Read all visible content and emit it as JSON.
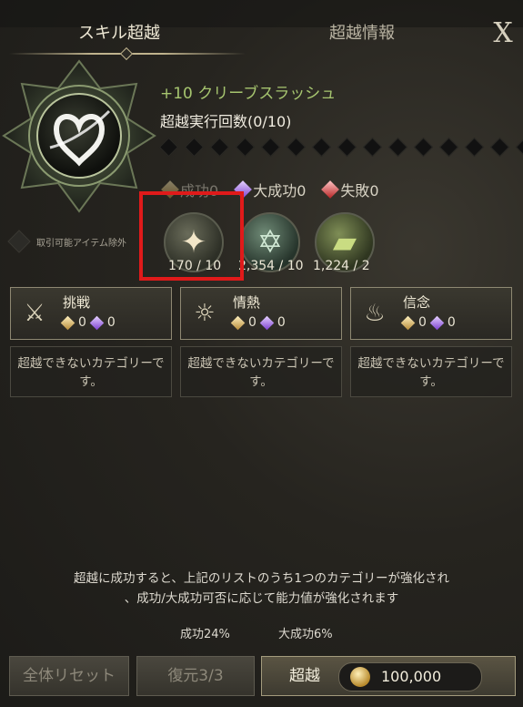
{
  "tabs": {
    "skill": "スキル超越",
    "info": "超越情報"
  },
  "close_label": "X",
  "skill": {
    "level_name": "+10 クリーブスラッシュ",
    "attempts": "超越実行回数(0/10)"
  },
  "legend": {
    "success": "成功0",
    "great_success": "大成功0",
    "failure": "失敗0"
  },
  "tradeable_label": "取引可能アイテム除外",
  "materials": [
    {
      "icon": "star-crystal-icon",
      "count": "170 / 10"
    },
    {
      "icon": "hexagram-crystal-icon",
      "count": "2,354 / 10"
    },
    {
      "icon": "scroll-icon",
      "count": "1,224 / 2"
    }
  ],
  "categories": [
    {
      "name": "挑戦",
      "icon": "sword-crest-icon",
      "gold": "0",
      "purple": "0",
      "note": "超越できないカテゴリーです。"
    },
    {
      "name": "情熱",
      "icon": "praying-hands-icon",
      "gold": "0",
      "purple": "0",
      "note": "超越できないカテゴリーです。"
    },
    {
      "name": "信念",
      "icon": "flame-icon",
      "gold": "0",
      "purple": "0",
      "note": "超越できないカテゴリーです。"
    }
  ],
  "description": {
    "line1": "超越に成功すると、上記のリストのうち1つのカテゴリーが強化され",
    "line2": "、成功/大成功可否に応じて能力値が強化されます"
  },
  "rates": {
    "success": "成功24%",
    "great_success": "大成功6%"
  },
  "buttons": {
    "reset": "全体リセット",
    "restore": "復元3/3",
    "transcend": "超越",
    "cost": "100,000"
  },
  "colors": {
    "level_text": "#a6c56f",
    "highlight": "#e01a1a",
    "gold_gem": "#c9a24f",
    "purple_gem": "#8c4ee0",
    "red_gem": "#c42a2a"
  }
}
